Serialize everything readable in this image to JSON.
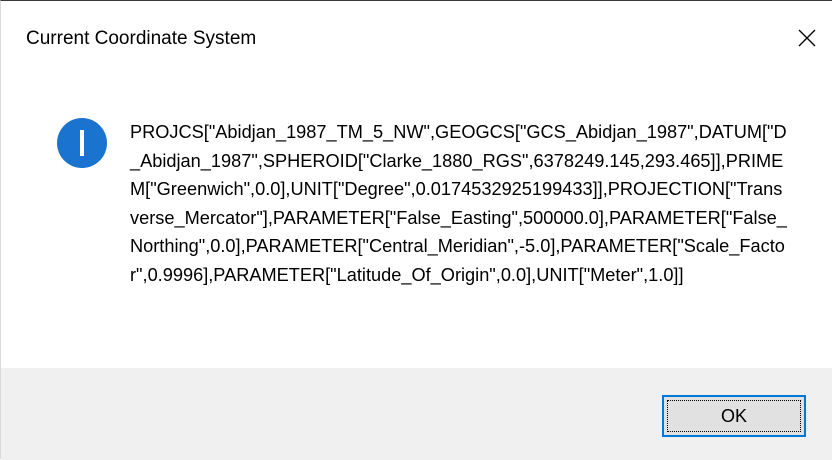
{
  "dialog": {
    "title": "Current Coordinate System",
    "icon": "info-icon",
    "close_icon": "close-icon",
    "message": "PROJCS[\"Abidjan_1987_TM_5_NW\",GEOGCS[\"GCS_Abidjan_1987\",DATUM[\"D_Abidjan_1987\",SPHEROID[\"Clarke_1880_RGS\",6378249.145,293.465]],PRIMEM[\"Greenwich\",0.0],UNIT[\"Degree\",0.0174532925199433]],PROJECTION[\"Transverse_Mercator\"],PARAMETER[\"False_Easting\",500000.0],PARAMETER[\"False_Northing\",0.0],PARAMETER[\"Central_Meridian\",-5.0],PARAMETER[\"Scale_Factor\",0.9996],PARAMETER[\"Latitude_Of_Origin\",0.0],UNIT[\"Meter\",1.0]]",
    "ok_label": "OK"
  },
  "colors": {
    "accent": "#0078d7",
    "footer_bg": "#f0f0f0",
    "button_bg": "#e1e1e1"
  }
}
